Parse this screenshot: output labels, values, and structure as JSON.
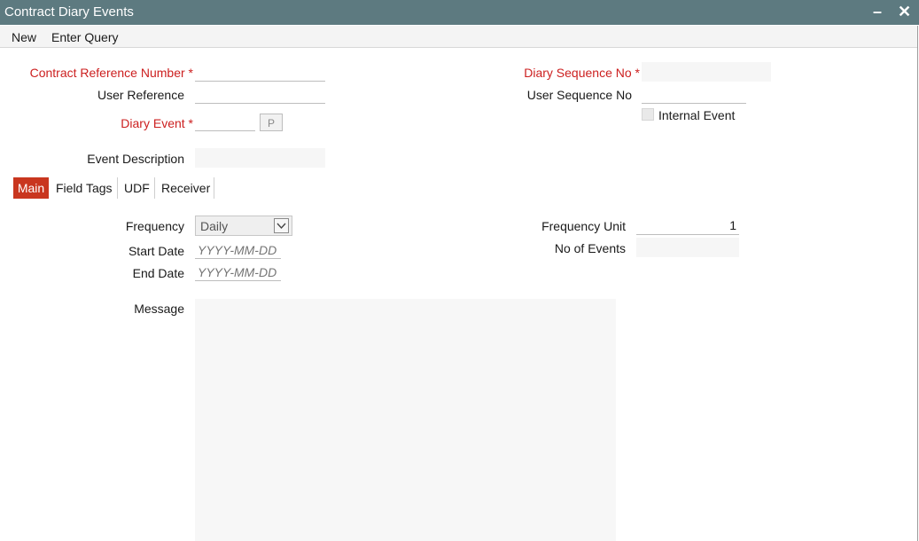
{
  "window": {
    "title": "Contract Diary Events",
    "minimize_glyph": "–",
    "close_glyph": "✕"
  },
  "menu": {
    "new_label": "New",
    "enter_query_label": "Enter Query"
  },
  "header": {
    "contract_ref_label": "Contract Reference Number",
    "user_reference_label": "User Reference",
    "diary_event_label": "Diary Event",
    "lov_button_label": "P",
    "event_description_label": "Event Description",
    "diary_seq_label": "Diary Sequence No",
    "user_seq_label": "User Sequence No",
    "internal_event_label": "Internal Event",
    "required_mark": "*"
  },
  "tabs": [
    {
      "label": "Main",
      "active": true
    },
    {
      "label": "Field Tags",
      "active": false
    },
    {
      "label": "UDF",
      "active": false
    },
    {
      "label": "Receiver",
      "active": false
    }
  ],
  "main": {
    "frequency_label": "Frequency",
    "frequency_value": "Daily",
    "start_date_label": "Start Date",
    "start_date_placeholder": "YYYY-MM-DD",
    "end_date_label": "End Date",
    "end_date_placeholder": "YYYY-MM-DD",
    "frequency_unit_label": "Frequency Unit",
    "frequency_unit_value": "1",
    "no_of_events_label": "No of Events",
    "message_label": "Message"
  },
  "colors": {
    "titlebar": "#5d7a80",
    "required": "#cc1f1f",
    "active_tab": "#c9361f"
  },
  "icons": {
    "minimize": "minimize-icon",
    "close": "close-icon",
    "dropdown": "chevron-down-icon"
  }
}
